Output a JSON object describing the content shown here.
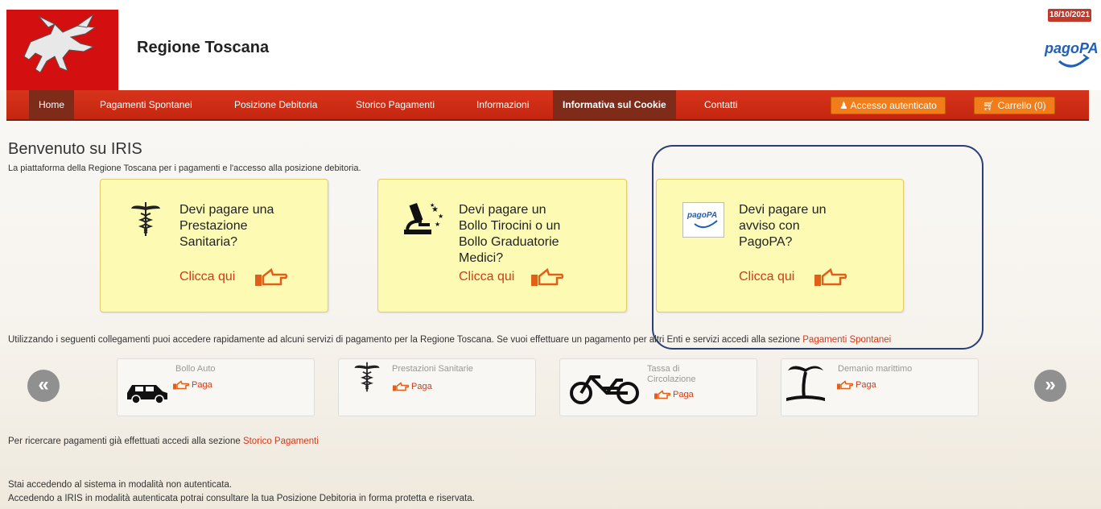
{
  "header": {
    "brand": "Regione Toscana",
    "date": "18/10/2021",
    "pagopa_logo": "pagoPA"
  },
  "nav": {
    "items": [
      "Home",
      "Pagamenti Spontanei",
      "Posizione Debitoria",
      "Storico Pagamenti",
      "Informazioni",
      "Informativa sul Cookie",
      "Contatti"
    ],
    "login": "Accesso autenticato",
    "cart": "Carrello (0)"
  },
  "main": {
    "title": "Benvenuto su IRIS",
    "subtitle": "La piattaforma della Regione Toscana per i pagamenti e l'accesso alla posizione debitoria.",
    "cards": [
      {
        "line1": "Devi pagare una",
        "line2": "Prestazione",
        "line3": "Sanitaria?",
        "line4": "",
        "cta": "Clicca qui"
      },
      {
        "line1": "Devi pagare un",
        "line2": "Bollo Tirocini o un",
        "line3": "Bollo Graduatorie",
        "line4": "Medici?",
        "cta": "Clicca qui"
      },
      {
        "line1": "Devi pagare un",
        "line2": "avviso con",
        "line3": "PagoPA?",
        "line4": "",
        "cta": "Clicca qui"
      }
    ],
    "card_logo": "pagoPA",
    "info_line": "Utilizzando i seguenti collegamenti puoi accedere rapidamente ad alcuni servizi di pagamento per la Regione Toscana. Se vuoi effettuare un pagamento per altri Enti e servizi accedi alla sezione",
    "info_link": "Pagamenti Spontanei",
    "services": [
      {
        "name": "Bollo Auto",
        "name2": "",
        "paga": "Paga"
      },
      {
        "name": "Prestazioni Sanitarie",
        "name2": "",
        "paga": "Paga"
      },
      {
        "name": "Tassa di",
        "name2": "Circolazione",
        "paga": "Paga"
      },
      {
        "name": "Demanio marittimo",
        "name2": "",
        "paga": "Paga"
      }
    ],
    "prev_symbol": "«",
    "next_symbol": "»",
    "storico_text": "Per ricercare pagamenti già effettuati accedi alla sezione",
    "storico_link": "Storico Pagamenti",
    "non_auth_1": "Stai accedendo al sistema in modalità non autenticata.",
    "non_auth_2": "Accedendo a IRIS in modalità autenticata potrai consultare la tua Posizione Debitoria in forma protetta e riservata."
  },
  "colors": {
    "nav_red": "#c4260f",
    "orange_button": "#f07d1a",
    "card_yellow": "#fdfab3",
    "link_red": "#d23a1a",
    "highlight": "#2c3e78"
  },
  "icons": [
    "pegasus-logo-icon",
    "pagopa-logo-icon",
    "user-icon",
    "cart-icon",
    "caduceus-icon",
    "microscope-icon",
    "thumb-pointer-icon",
    "car-icon",
    "bicycle-icon",
    "palm-icon",
    "chevron-left-icon",
    "chevron-right-icon"
  ]
}
